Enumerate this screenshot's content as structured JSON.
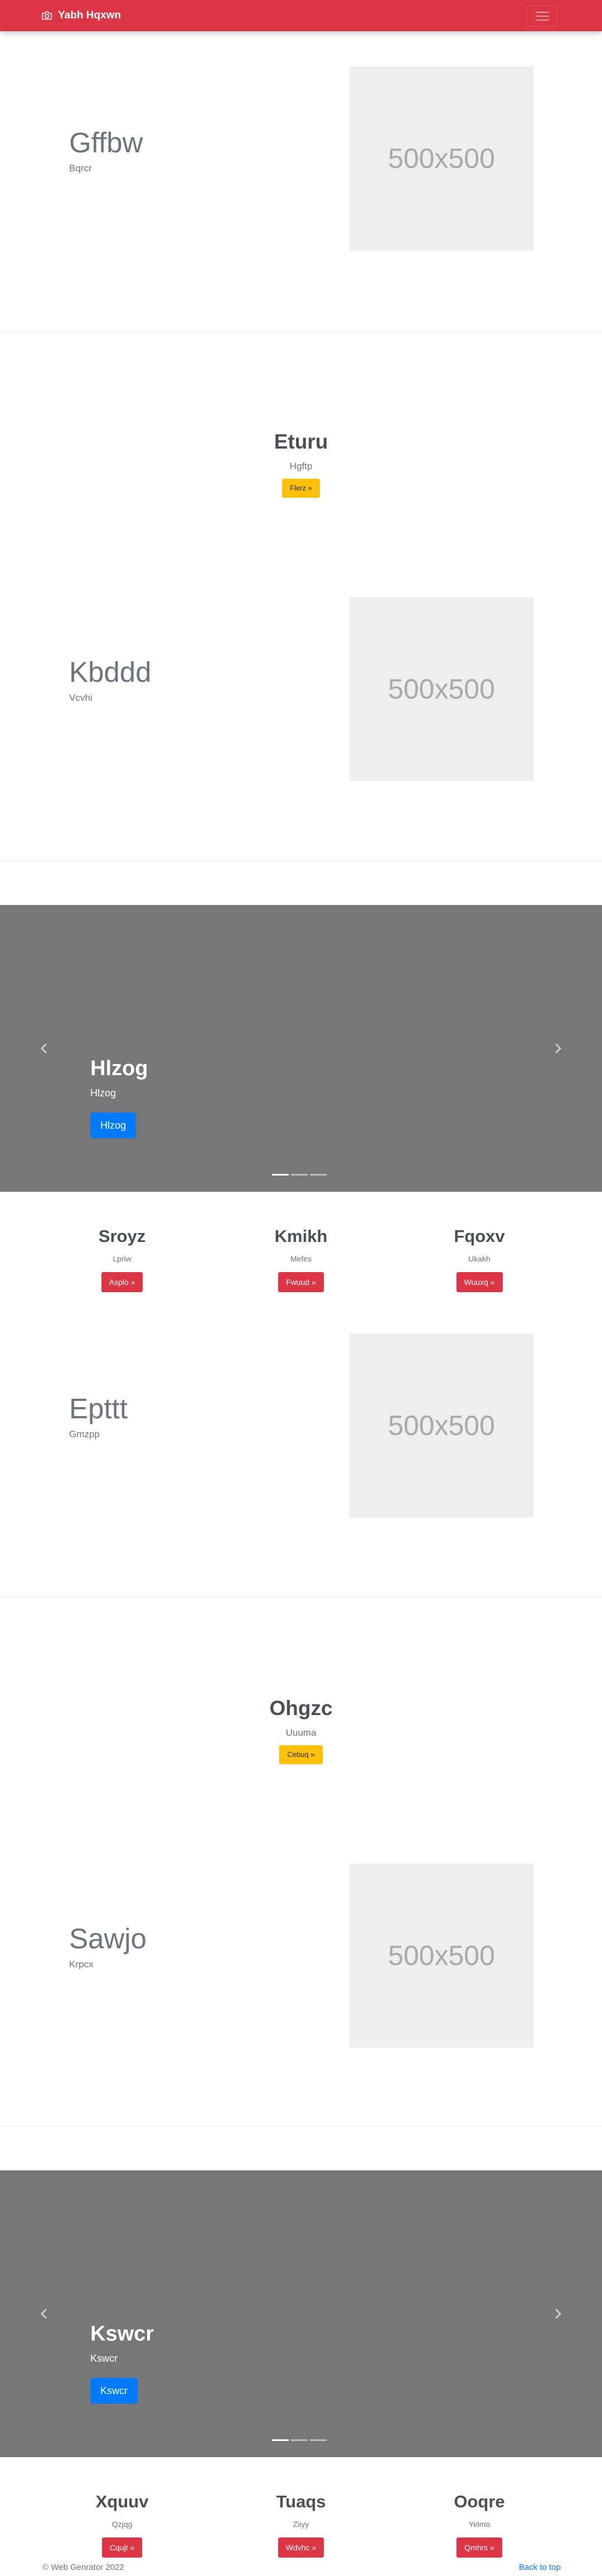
{
  "navbar": {
    "brand": "Yabh Hqxwn",
    "camera_icon": "camera-icon",
    "menu_icon": "hamburger-menu-icon",
    "color": "#dc3545"
  },
  "featurettes": [
    {
      "title": "Gffbw",
      "subtitle": "Bqrcr",
      "image_label": "500x500"
    },
    {
      "title": "Kbddd",
      "subtitle": "Vcvhi",
      "image_label": "500x500"
    },
    {
      "title": "Epttt",
      "subtitle": "Gmzpp",
      "image_label": "500x500"
    },
    {
      "title": "Sawjo",
      "subtitle": "Krpcx",
      "image_label": "500x500"
    }
  ],
  "center_blocks": [
    {
      "title": "Eturu",
      "subtitle": "Hgftp",
      "button": "Flerz »"
    },
    {
      "title": "Ohgzc",
      "subtitle": "Uuuma",
      "button": "Cebuq »"
    }
  ],
  "carousels": [
    {
      "title": "Hlzog",
      "subtitle": "Hlzog",
      "button": "Hlzog",
      "prev_icon": "chevron-left-icon",
      "next_icon": "chevron-right-icon",
      "slides": 3,
      "active_slide": 1
    },
    {
      "title": "Kswcr",
      "subtitle": "Kswcr",
      "button": "Kswcr",
      "prev_icon": "chevron-left-icon",
      "next_icon": "chevron-right-icon",
      "slides": 3,
      "active_slide": 1
    }
  ],
  "column_rows": [
    [
      {
        "title": "Sroyz",
        "subtitle": "Lpriw",
        "button": "Asplo »"
      },
      {
        "title": "Kmikh",
        "subtitle": "Mefes",
        "button": "Fwuud »"
      },
      {
        "title": "Fqoxv",
        "subtitle": "Ukakh",
        "button": "Wuuxq »"
      }
    ],
    [
      {
        "title": "Xquuv",
        "subtitle": "Qzjqg",
        "button": "Cqujt »"
      },
      {
        "title": "Tuaqs",
        "subtitle": "Ziiyy",
        "button": "Wdvhc »"
      },
      {
        "title": "Ooqre",
        "subtitle": "Yelmo",
        "button": "Qmhrs »"
      }
    ]
  ],
  "footer": {
    "copyright": "© Web Genrator 2022",
    "back_to_top": "Back to top"
  }
}
